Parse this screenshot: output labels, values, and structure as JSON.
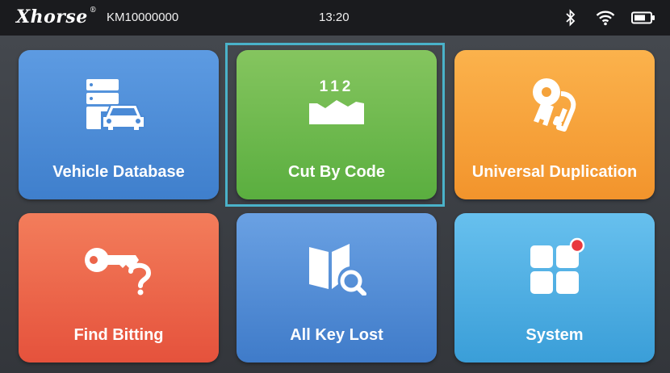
{
  "status_bar": {
    "brand": "Xhorse",
    "brand_mark": "®",
    "serial": "KM10000000",
    "time": "13:20",
    "icons": [
      "bluetooth-icon",
      "wifi-icon",
      "battery-icon"
    ]
  },
  "menu": {
    "selected": "Cut By Code",
    "tiles": [
      {
        "label": "Vehicle Database",
        "icon": "vehicle-database-icon",
        "color": "#4a8ad6"
      },
      {
        "label": "Cut By Code",
        "icon": "cut-by-code-icon",
        "icon_text": "112",
        "color": "#6cb84b"
      },
      {
        "label": "Universal Duplication",
        "icon": "keys-icon",
        "color": "#f5a23a"
      },
      {
        "label": "Find Bitting",
        "icon": "key-question-icon",
        "color": "#ec6449"
      },
      {
        "label": "All Key Lost",
        "icon": "book-search-icon",
        "color": "#4f8cd6"
      },
      {
        "label": "System",
        "icon": "apps-grid-icon",
        "color": "#4eaee2"
      }
    ]
  },
  "colors": {
    "status_bg": "#1a1b1e",
    "background": "#3a3d42",
    "selection_border": "#4ab2c9",
    "notification_dot": "#e8383d"
  }
}
